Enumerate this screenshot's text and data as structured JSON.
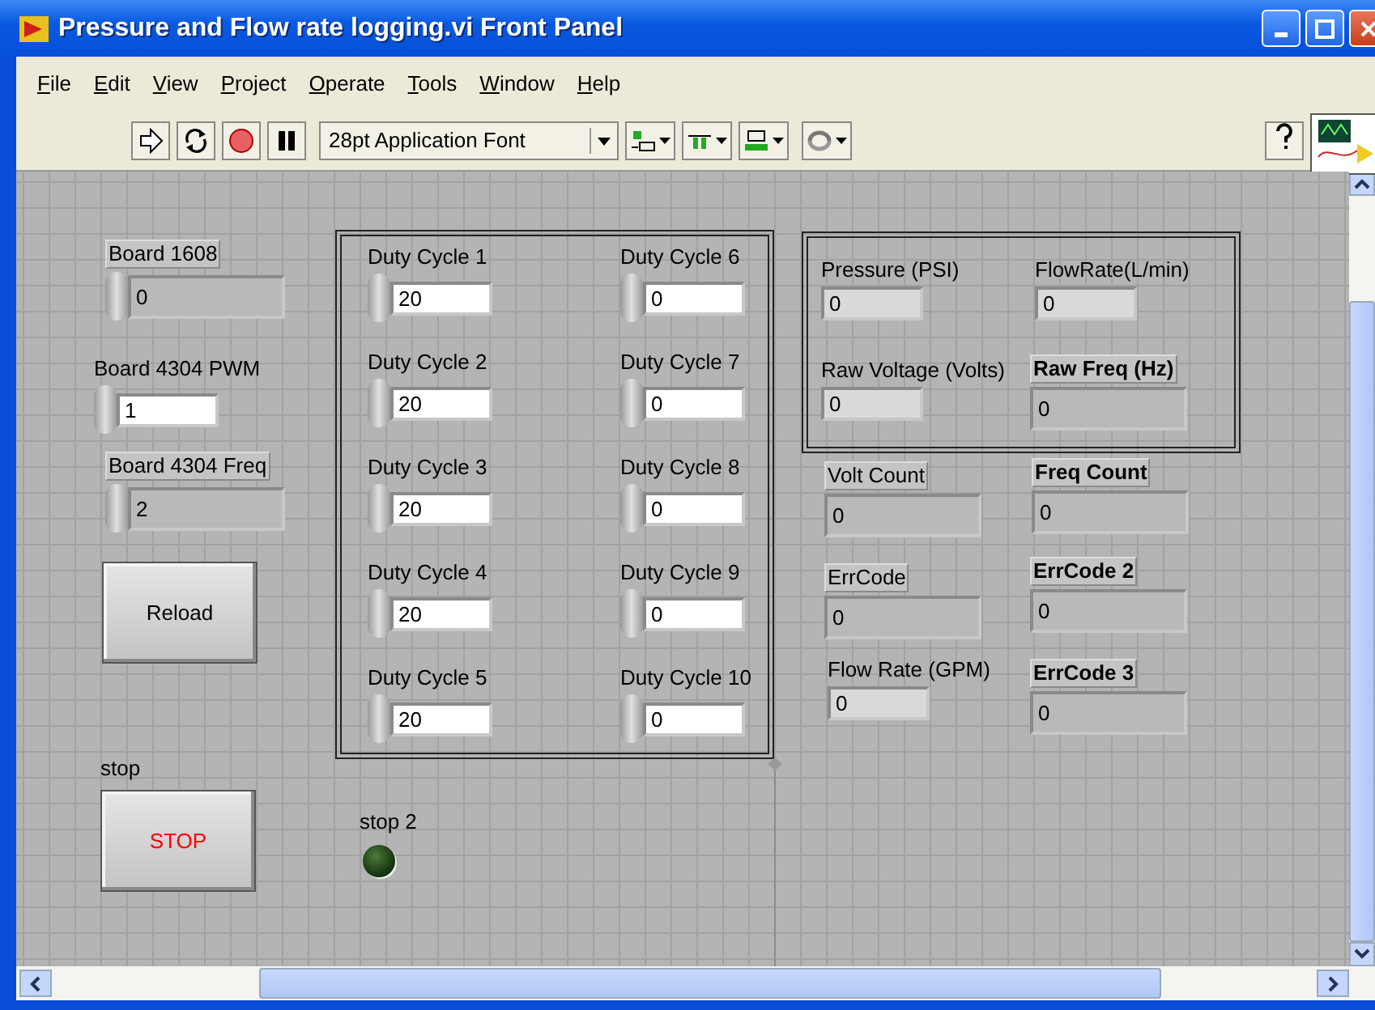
{
  "window": {
    "title": "Pressure and Flow rate logging.vi Front Panel"
  },
  "menu": [
    "File",
    "Edit",
    "View",
    "Project",
    "Operate",
    "Tools",
    "Window",
    "Help"
  ],
  "toolbar": {
    "font": "28pt Application Font"
  },
  "controls": [
    {
      "kind": "numeric-control",
      "label": "Board 1608",
      "value": "0",
      "disabled": true,
      "label_framed": true,
      "label_bold": false
    },
    {
      "kind": "numeric-control",
      "label": "Board 4304 PWM",
      "value": "1",
      "disabled": false,
      "label_framed": false,
      "label_bold": false
    },
    {
      "kind": "numeric-control",
      "label": "Board 4304 Freq",
      "value": "2",
      "disabled": true,
      "label_framed": true,
      "label_bold": false
    },
    {
      "kind": "button",
      "text": "Reload",
      "color": "#000000"
    },
    {
      "kind": "button",
      "label": "stop",
      "text": "STOP",
      "color": "#ff0000"
    },
    {
      "kind": "led",
      "label": "stop 2",
      "on": false
    }
  ],
  "duty_cycles": [
    {
      "label": "Duty Cycle 1",
      "value": "20"
    },
    {
      "label": "Duty Cycle 2",
      "value": "20"
    },
    {
      "label": "Duty Cycle 3",
      "value": "20"
    },
    {
      "label": "Duty Cycle 4",
      "value": "20"
    },
    {
      "label": "Duty Cycle 5",
      "value": "20"
    },
    {
      "label": "Duty Cycle 6",
      "value": "0"
    },
    {
      "label": "Duty Cycle 7",
      "value": "0"
    },
    {
      "label": "Duty Cycle 8",
      "value": "0"
    },
    {
      "label": "Duty Cycle 9",
      "value": "0"
    },
    {
      "label": "Duty Cycle 10",
      "value": "0"
    }
  ],
  "readings": [
    {
      "label": "Pressure (PSI)",
      "value": "0",
      "disabled": false,
      "label_framed": false,
      "label_bold": false
    },
    {
      "label": "FlowRate(L/min)",
      "value": "0",
      "disabled": false,
      "label_framed": false,
      "label_bold": false
    },
    {
      "label": "Raw Voltage (Volts)",
      "value": "0",
      "disabled": false,
      "label_framed": false,
      "label_bold": false
    },
    {
      "label": "Raw Freq (Hz)",
      "value": "0",
      "disabled": true,
      "label_framed": true,
      "label_bold": true
    }
  ],
  "indicators": [
    {
      "label": "Volt Count",
      "value": "0",
      "disabled": true,
      "label_framed": true,
      "label_bold": false
    },
    {
      "label": "Freq Count",
      "value": "0",
      "disabled": true,
      "label_framed": true,
      "label_bold": true
    },
    {
      "label": "ErrCode",
      "value": "0",
      "disabled": true,
      "label_framed": true,
      "label_bold": false
    },
    {
      "label": "ErrCode 2",
      "value": "0",
      "disabled": true,
      "label_framed": true,
      "label_bold": true
    },
    {
      "label": "Flow Rate (GPM)",
      "value": "0",
      "disabled": false,
      "label_framed": false,
      "label_bold": false
    },
    {
      "label": "ErrCode 3",
      "value": "0",
      "disabled": true,
      "label_framed": true,
      "label_bold": true
    }
  ]
}
